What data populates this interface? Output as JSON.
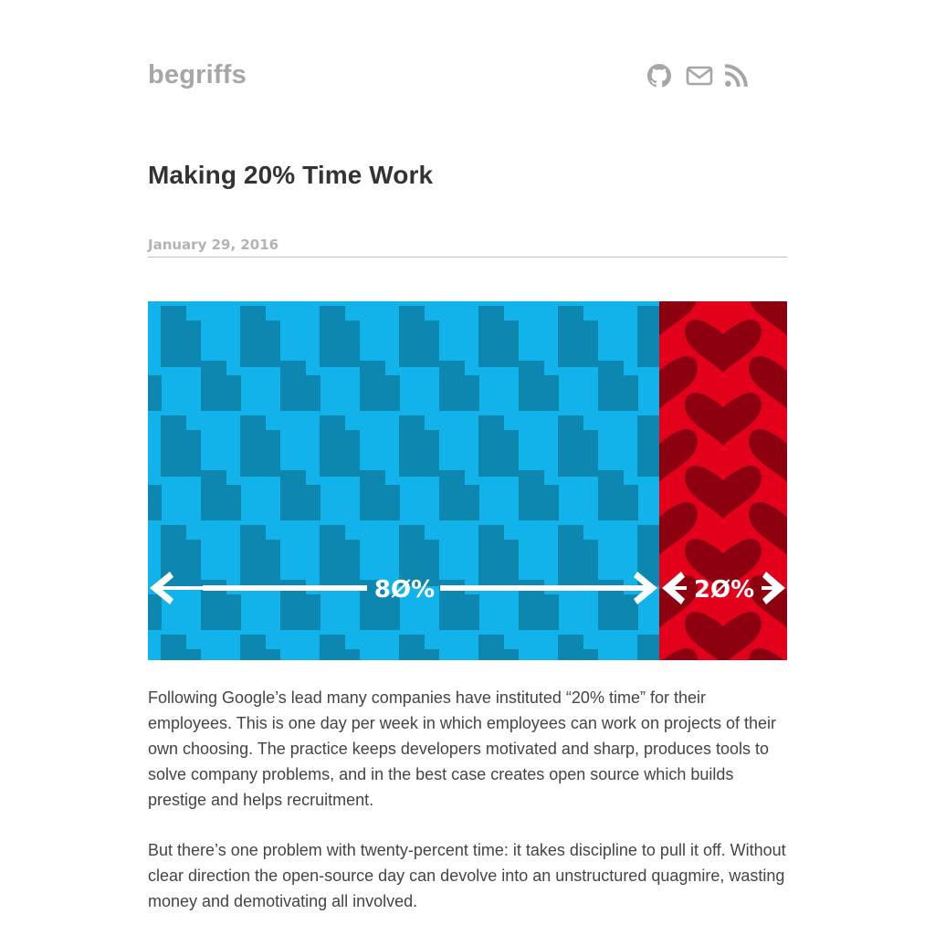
{
  "site": {
    "title": "begriffs",
    "social_icons": [
      "github-icon",
      "mail-icon",
      "rss-icon"
    ]
  },
  "post": {
    "title": "Making 20% Time Work",
    "date": "January 29, 2016",
    "hero": {
      "left_label": "8Ø%",
      "right_label": "2Ø%",
      "left_color": "#11b3ea",
      "left_icon_color": "#0d86b0",
      "right_color": "#e2001a",
      "right_icon_color": "#8c0010",
      "left_icon": "document-icon",
      "right_icon": "heart-icon"
    },
    "paragraphs": [
      "Following Google’s lead many companies have instituted “20% time” for their employees. This is one day per week in which employees can work on projects of their own choosing. The practice keeps developers motivated and sharp, produces tools to solve company problems, and in the best case creates open source which builds prestige and helps recruitment.",
      "But there’s one problem with twenty-percent time: it takes discipline to pull it off. Without clear direction the open-source day can devolve into an unstructured quagmire, wasting money and demotivating all involved."
    ]
  },
  "colors": {
    "site_title": "#a6a6a6",
    "icon": "#a6a6a6",
    "date": "#b3b3b3",
    "text": "#444444"
  }
}
